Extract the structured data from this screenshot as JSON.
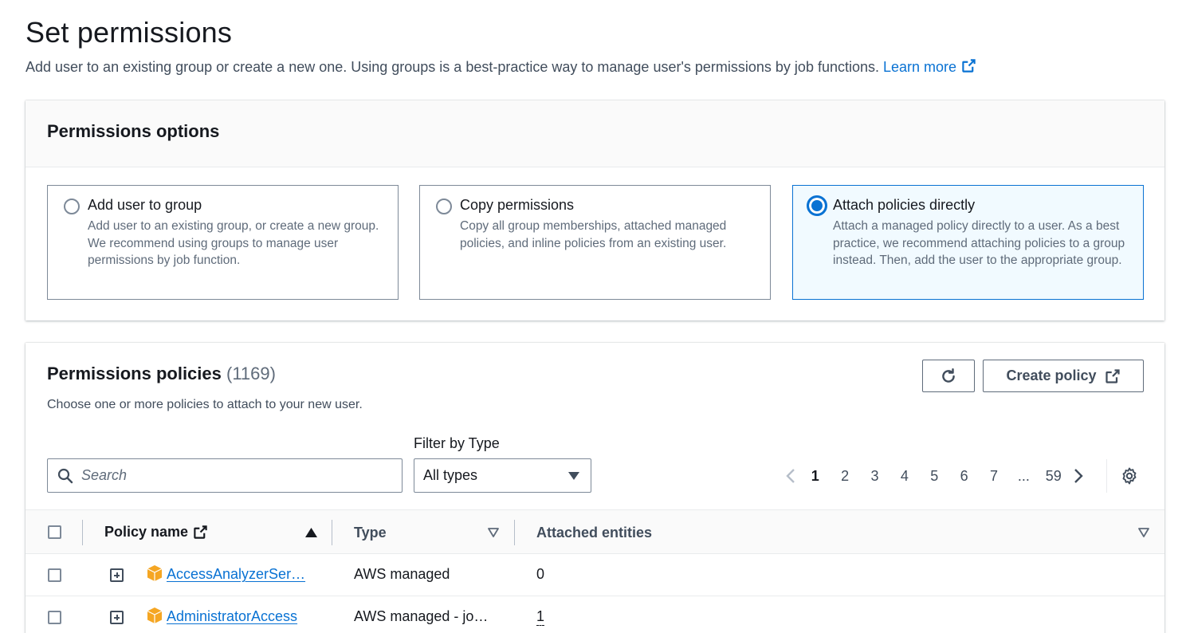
{
  "header": {
    "title": "Set permissions",
    "description": "Add user to an existing group or create a new one. Using groups is a best-practice way to manage user's permissions by job functions.",
    "learn_more": "Learn more"
  },
  "permissions_options": {
    "title": "Permissions options",
    "options": [
      {
        "title": "Add user to group",
        "description": "Add user to an existing group, or create a new group. We recommend using groups to manage user permissions by job function.",
        "selected": false
      },
      {
        "title": "Copy permissions",
        "description": "Copy all group memberships, attached managed policies, and inline policies from an existing user.",
        "selected": false
      },
      {
        "title": "Attach policies directly",
        "description": "Attach a managed policy directly to a user. As a best practice, we recommend attaching policies to a group instead. Then, add the user to the appropriate group.",
        "selected": true
      }
    ]
  },
  "policies": {
    "title": "Permissions policies",
    "count": "(1169)",
    "subtitle": "Choose one or more policies to attach to your new user.",
    "create_label": "Create policy",
    "filter_label": "Filter by Type",
    "search_placeholder": "Search",
    "filter_value": "All types",
    "pagination": {
      "pages": [
        "1",
        "2",
        "3",
        "4",
        "5",
        "6",
        "7",
        "...",
        "59"
      ],
      "current": "1"
    },
    "columns": {
      "name": "Policy name",
      "type": "Type",
      "attached": "Attached entities"
    },
    "rows": [
      {
        "name": "AccessAnalyzerSer…",
        "type": "AWS managed",
        "attached": "0"
      },
      {
        "name": "AdministratorAccess",
        "type": "AWS managed - jo…",
        "attached": "1"
      }
    ]
  },
  "colors": {
    "accent": "#0972d3",
    "selected_bg": "#f1faff",
    "aws_orange": "#f5a623"
  }
}
